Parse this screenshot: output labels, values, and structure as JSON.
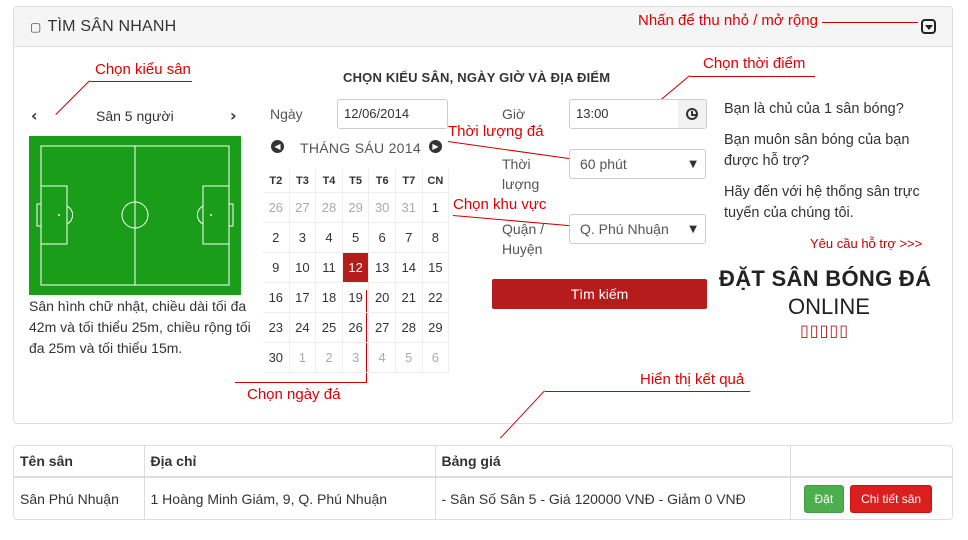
{
  "panel": {
    "title_icon": "▢",
    "title": "TÌM SÂN NHANH"
  },
  "annotations": {
    "collapse": "Nhấn để thu nhỏ / mở rộng",
    "field_type": "Chọn kiểu sân",
    "time": "Chọn thời điểm",
    "duration": "Thời lượng đá",
    "area": "Chọn khu vực",
    "date": "Chọn ngày đá",
    "results": "Hiển thị kết quả"
  },
  "form": {
    "title": "CHỌN KIỂU SÂN, NGÀY GIỜ VÀ ĐỊA ĐIỂM",
    "field_type": "Sân 5 người",
    "field_description": "Sân hình chữ nhật, chiều dài tối đa 42m và tối thiểu 25m, chiều rộng tối đa 25m và tối thiểu 15m.",
    "date_label": "Ngày",
    "date_value": "12/06/2014",
    "time_label": "Giờ",
    "time_value": "13:00",
    "duration_label": "Thời lượng",
    "duration_value": "60 phút",
    "district_label": "Quận / Huyện",
    "district_value": "Q. Phú Nhuận",
    "search_button": "Tìm kiếm"
  },
  "calendar": {
    "month_label": "THÁNG SÁU 2014",
    "weekdays": [
      "T2",
      "T3",
      "T4",
      "T5",
      "T6",
      "T7",
      "CN"
    ],
    "weeks": [
      [
        "26",
        "27",
        "28",
        "29",
        "30",
        "31",
        "1"
      ],
      [
        "2",
        "3",
        "4",
        "5",
        "6",
        "7",
        "8"
      ],
      [
        "9",
        "10",
        "11",
        "12",
        "13",
        "14",
        "15"
      ],
      [
        "16",
        "17",
        "18",
        "19",
        "20",
        "21",
        "22"
      ],
      [
        "23",
        "24",
        "25",
        "26",
        "27",
        "28",
        "29"
      ],
      [
        "30",
        "1",
        "2",
        "3",
        "4",
        "5",
        "6"
      ]
    ],
    "selected": "12"
  },
  "side": {
    "p1": "Bạn là chủ của 1 sân bóng?",
    "p2": "Bạn muôn sân bóng của bạn được hỗ trợ?",
    "p3": "Hãy đến với hệ thống sân trực tuyến của chúng tôi.",
    "support_link": "Yêu cầu hỗ trợ >>>",
    "big_line1": "ĐẶT SÂN BÓNG ĐÁ",
    "big_line2": "ONLINE",
    "stars": "▯▯▯▯▯"
  },
  "results": {
    "headers": [
      "Tên sân",
      "Địa chỉ",
      "Bảng giá",
      ""
    ],
    "rows": [
      {
        "name": "Sân Phú Nhuận",
        "address": "1 Hoàng Minh Giám, 9, Q. Phú Nhuận",
        "price": "- Sân Số Sân 5 - Giá 120000 VNĐ - Giảm 0 VNĐ",
        "book_label": "Đặt",
        "detail_label": "Chi tiết sân"
      }
    ]
  },
  "colors": {
    "accent": "#b71c1c",
    "annotation": "#e00000",
    "field": "#1a9e1a",
    "book_button": "#4cae4c"
  }
}
